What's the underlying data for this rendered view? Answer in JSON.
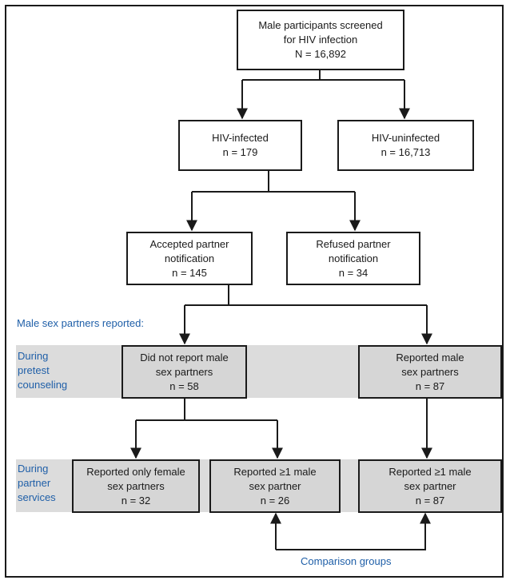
{
  "diagram": {
    "colors": {
      "stroke": "#1a1a1a",
      "band": "#dcdcdc",
      "label_blue": "#1f5fa8"
    },
    "nodes": {
      "screened": {
        "lines": [
          "Male participants screened",
          "for  HIV infection",
          "N = 16,892"
        ]
      },
      "hiv_infected": {
        "lines": [
          "HIV-infected",
          "n = 179"
        ]
      },
      "hiv_uninfected": {
        "lines": [
          "HIV-uninfected",
          "n = 16,713"
        ]
      },
      "accepted": {
        "lines": [
          "Accepted partner",
          "notification",
          "n = 145"
        ]
      },
      "refused": {
        "lines": [
          "Refused partner",
          "notification",
          "n = 34"
        ]
      },
      "did_not_report": {
        "lines": [
          "Did not report male",
          "sex partners",
          "n = 58"
        ]
      },
      "reported_male": {
        "lines": [
          "Reported male",
          "sex partners",
          "n = 87"
        ]
      },
      "only_female": {
        "lines": [
          "Reported only female",
          "sex partners",
          "n = 32"
        ]
      },
      "ge1_male_a": {
        "lines": [
          "Reported ≥1 male",
          "sex partner",
          "n = 26"
        ]
      },
      "ge1_male_b": {
        "lines": [
          "Reported ≥1 male",
          "sex partner",
          "n = 87"
        ]
      }
    },
    "labels": {
      "male_partners_reported": "Male sex partners reported:",
      "pretest": [
        "During",
        "pretest",
        "counseling"
      ],
      "partner_services": [
        "During",
        "partner",
        "services"
      ],
      "comparison": "Comparison groups"
    }
  }
}
